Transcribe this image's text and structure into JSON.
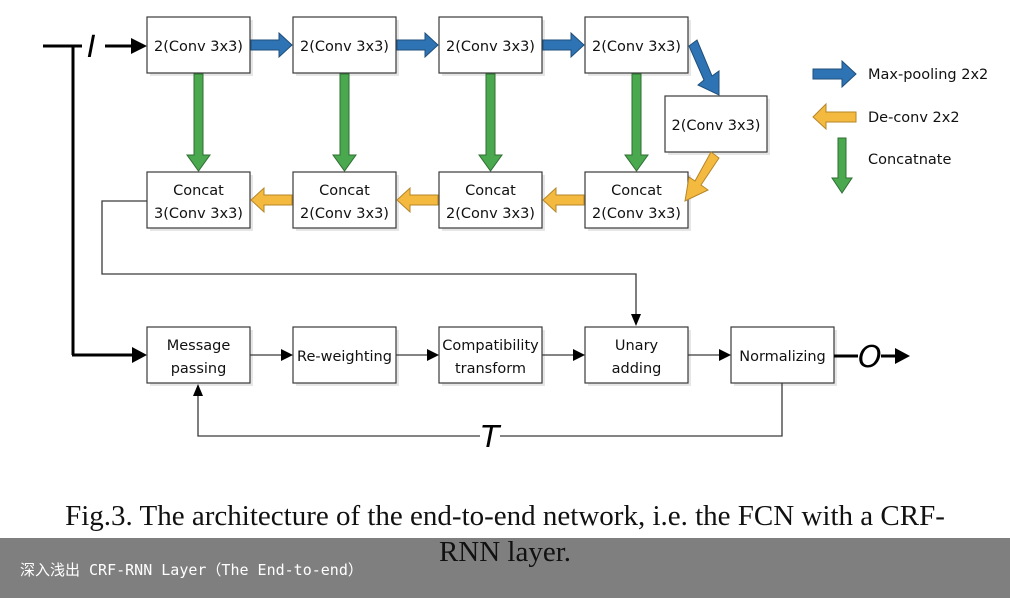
{
  "diagram": {
    "input_label": "I",
    "output_label": "O",
    "loop_label": "T",
    "encoder": [
      {
        "label": "2(Conv 3x3)"
      },
      {
        "label": "2(Conv 3x3)"
      },
      {
        "label": "2(Conv 3x3)"
      },
      {
        "label": "2(Conv 3x3)"
      }
    ],
    "bottleneck": {
      "label": "2(Conv 3x3)"
    },
    "decoder": [
      {
        "line1": "Concat",
        "line2": "3(Conv 3x3)"
      },
      {
        "line1": "Concat",
        "line2": "2(Conv 3x3)"
      },
      {
        "line1": "Concat",
        "line2": "2(Conv 3x3)"
      },
      {
        "line1": "Concat",
        "line2": "2(Conv 3x3)"
      }
    ],
    "crf": [
      {
        "line1": "Message",
        "line2": "passing"
      },
      {
        "line1": "Re-weighting",
        "line2": ""
      },
      {
        "line1": "Compatibility",
        "line2": "transform"
      },
      {
        "line1": "Unary",
        "line2": "adding"
      },
      {
        "line1": "Normalizing",
        "line2": ""
      }
    ],
    "legend": [
      {
        "label": "Max-pooling 2x2",
        "icon": "blue-right-arrow",
        "color": "#2e74b5"
      },
      {
        "label": "De-conv 2x2",
        "icon": "yellow-left-arrow",
        "color": "#f4b93f"
      },
      {
        "label": "Concatnate",
        "icon": "green-down-arrow",
        "color": "#4aa84f"
      }
    ],
    "colors": {
      "maxpool": "#2e74b5",
      "deconv": "#f4b93f",
      "concat": "#4aa84f",
      "outline": "#3a3a3a"
    }
  },
  "caption": {
    "line1": "Fig.3. The architecture of the end-to-end network, i.e. the FCN with a CRF-",
    "line2": "RNN layer."
  },
  "footer": {
    "text": "深入浅出 CRF-RNN Layer（The End-to-end）",
    "background": "#7f7f7f"
  }
}
